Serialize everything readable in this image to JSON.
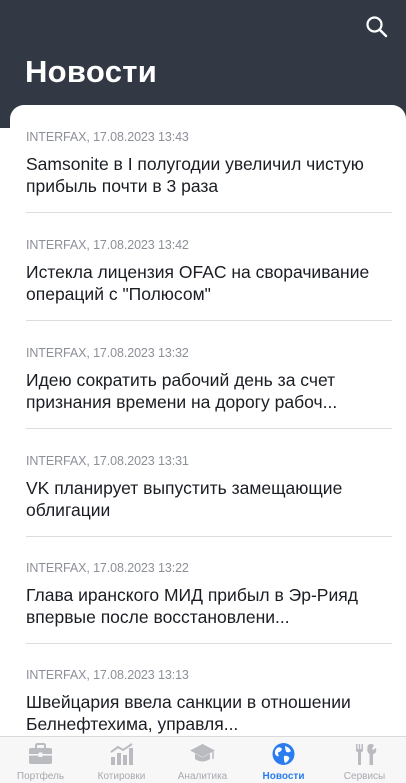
{
  "header": {
    "title": "Новости",
    "search_icon": "search-icon"
  },
  "news": [
    {
      "source_time": "INTERFAX, 17.08.2023 13:43",
      "headline": "Samsonite в I полугодии увеличил чистую прибыль почти в 3 раза"
    },
    {
      "source_time": "INTERFAX, 17.08.2023 13:42",
      "headline": "Истекла лицензия OFAC на сворачивание операций с \"Полюсом\""
    },
    {
      "source_time": "INTERFAX, 17.08.2023 13:32",
      "headline": "Идею сократить рабочий день за счет признания времени на дорогу рабоч..."
    },
    {
      "source_time": "INTERFAX, 17.08.2023 13:31",
      "headline": "VK планирует выпустить замещающие облигации"
    },
    {
      "source_time": "INTERFAX, 17.08.2023 13:22",
      "headline": "Глава иранского МИД прибыл в Эр-Рияд впервые после восстановлени..."
    },
    {
      "source_time": "INTERFAX, 17.08.2023 13:13",
      "headline": "Швейцария ввела санкции в отношении Белнефтехима, управля..."
    }
  ],
  "tabs": [
    {
      "label": "Портфель",
      "icon": "briefcase-icon",
      "active": false
    },
    {
      "label": "Котировки",
      "icon": "chart-icon",
      "active": false
    },
    {
      "label": "Аналитика",
      "icon": "graduation-cap-icon",
      "active": false
    },
    {
      "label": "Новости",
      "icon": "globe-icon",
      "active": true
    },
    {
      "label": "Сервисы",
      "icon": "tools-icon",
      "active": false
    }
  ],
  "colors": {
    "header_bg": "#333845",
    "accent": "#2a7cf0",
    "inactive_icon": "#b9bbc0",
    "meta_text": "#8b8f97"
  }
}
